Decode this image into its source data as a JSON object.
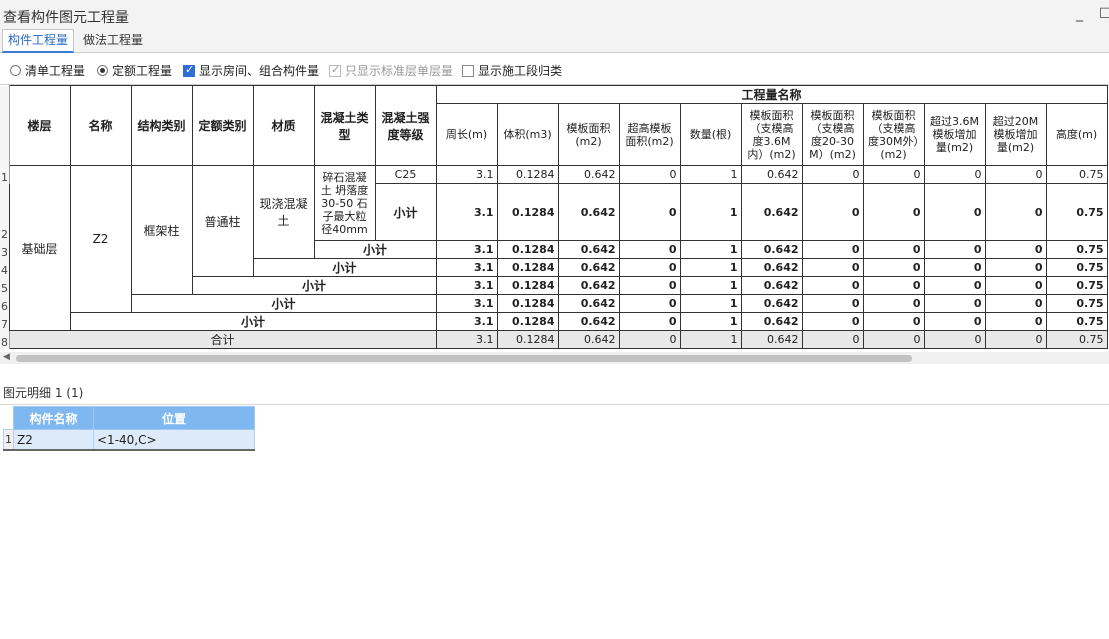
{
  "window": {
    "title": "查看构件图元工程量",
    "minimize": "_",
    "maximize": "☐"
  },
  "tabs": [
    "构件工程量",
    "做法工程量"
  ],
  "options": {
    "radio_list": "清单工程量",
    "radio_quota": "定额工程量",
    "chk_rooms": "显示房间、组合构件量",
    "chk_std_floor": "只显示标准层单层量",
    "chk_section": "显示施工段归类"
  },
  "grid": {
    "group_header": "工程量名称",
    "headers": {
      "floor": "楼层",
      "name": "名称",
      "struct": "结构类别",
      "quota": "定额类别",
      "material": "材质",
      "concrete_type": "混凝土类型",
      "concrete_grade": "混凝土强度等级"
    },
    "qty_headers": [
      "周长(m)",
      "体积(m3)",
      "模板面积(m2)",
      "超高模板面积(m2)",
      "数量(根)",
      "模板面积（支模高度3.6M内）(m2)",
      "模板面积（支模高度20-30M）(m2)",
      "模板面积（支模高度30M外）(m2)",
      "超过3.6M模板增加量(m2)",
      "超过20M模板增加量(m2)",
      "高度(m)"
    ],
    "row_numbers": [
      "1",
      "2",
      "3",
      "4",
      "5",
      "6",
      "7",
      "8"
    ],
    "cells": {
      "floor": "基础层",
      "name": "Z2",
      "struct": "框架柱",
      "quota": "普通柱",
      "material": "现浇混凝土",
      "concrete_type": "碎石混凝土 坍落度30-50 石子最大粒径40mm",
      "grade": "C25",
      "subtotal": "小计",
      "total": "合计"
    },
    "values": [
      "3.1",
      "0.1284",
      "0.642",
      "0",
      "1",
      "0.642",
      "0",
      "0",
      "0",
      "0",
      "0.75"
    ]
  },
  "detail": {
    "label": "图元明细  1 (1)",
    "headers": [
      "构件名称",
      "位置"
    ],
    "rows": [
      {
        "num": "1",
        "name": "Z2",
        "position": "<1-40,C>"
      }
    ]
  }
}
